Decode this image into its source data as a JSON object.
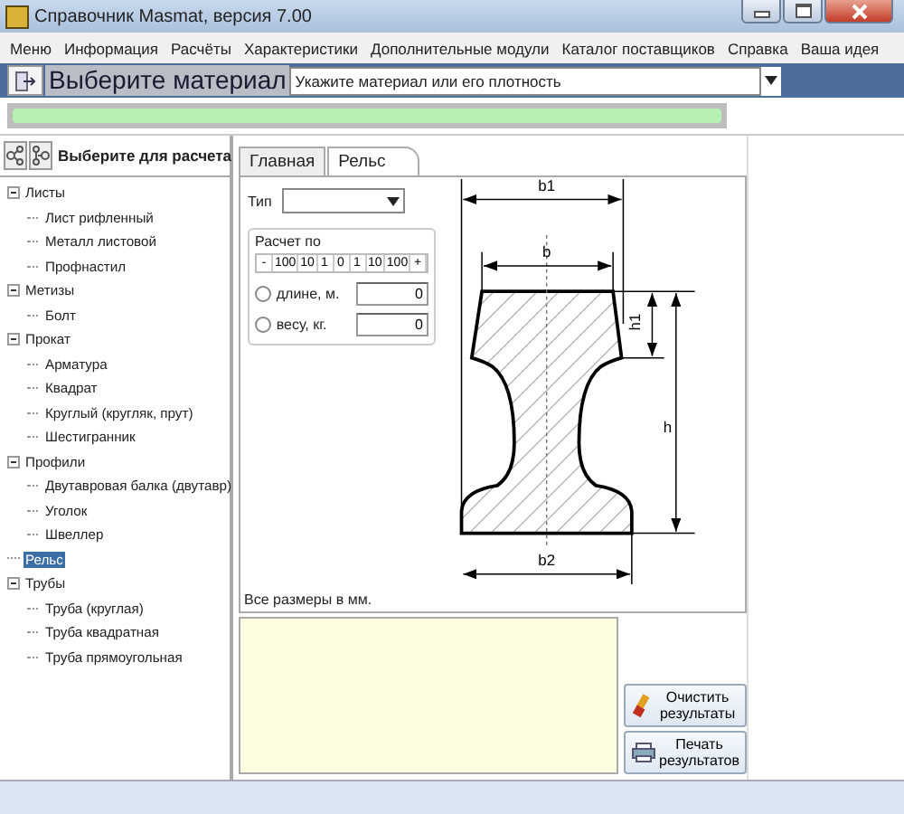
{
  "window": {
    "title": "Справочник Masmat, версия 7.00"
  },
  "menu": [
    "Меню",
    "Информация",
    "Расчёты",
    "Характеристики",
    "Дополнительные модули",
    "Каталог поставщиков",
    "Справка",
    "Ваша идея"
  ],
  "toolbar": {
    "label": "Выберите материал",
    "material": {
      "placeholder": "Укажите материал или его плотность"
    },
    "progress": {
      "level": 1
    }
  },
  "sidebar": {
    "title": "Выберите для расчета",
    "items": [
      {
        "label": "Листы",
        "expanded": true,
        "selected": false,
        "children": [
          {
            "label": "Лист рифленный",
            "selected": false
          },
          {
            "label": "Металл листовой",
            "selected": false
          },
          {
            "label": "Профнастил",
            "selected": false
          }
        ]
      },
      {
        "label": "Метизы",
        "expanded": true,
        "selected": false,
        "children": [
          {
            "label": "Болт",
            "selected": false
          }
        ]
      },
      {
        "label": "Прокат",
        "expanded": true,
        "selected": false,
        "children": [
          {
            "label": "Арматура",
            "selected": false
          },
          {
            "label": "Квадрат",
            "selected": false
          },
          {
            "label": "Круглый (кругляк, прут)",
            "selected": false
          },
          {
            "label": "Шестигранник",
            "selected": false
          }
        ]
      },
      {
        "label": "Профили",
        "expanded": true,
        "selected": false,
        "children": [
          {
            "label": "Двутавровая балка (двутавр)",
            "selected": false
          },
          {
            "label": "Уголок",
            "selected": false
          },
          {
            "label": "Швеллер",
            "selected": false
          }
        ]
      },
      {
        "label": "Рельс",
        "selected": true
      },
      {
        "label": "Трубы",
        "expanded": true,
        "selected": false,
        "children": [
          {
            "label": "Труба (круглая)",
            "selected": false
          },
          {
            "label": "Труба квадратная",
            "selected": false
          },
          {
            "label": "Труба прямоугольная",
            "selected": false
          }
        ]
      }
    ]
  },
  "tabs": [
    {
      "label": "Главная",
      "selected": false
    },
    {
      "label": "Рельс",
      "selected": true
    }
  ],
  "form": {
    "type_label": "Тип",
    "group_title": "Расчет по",
    "steps": [
      "-",
      "100",
      "10",
      "1",
      "0",
      "1",
      "10",
      "100",
      "+"
    ],
    "options": [
      {
        "label": "длине, м.",
        "value": "0",
        "selected": false
      },
      {
        "label": "весу, кг.",
        "value": "0",
        "selected": false
      }
    ],
    "note": "Все размеры в мм."
  },
  "drawing": {
    "labels": {
      "b1": "b1",
      "b": "b",
      "h1": "h1",
      "h": "h",
      "b2": "b2"
    }
  },
  "results": {
    "buttons": [
      {
        "kind": "clear",
        "label": "Очистить результаты"
      },
      {
        "kind": "print",
        "label": "Печать результатов"
      }
    ]
  }
}
